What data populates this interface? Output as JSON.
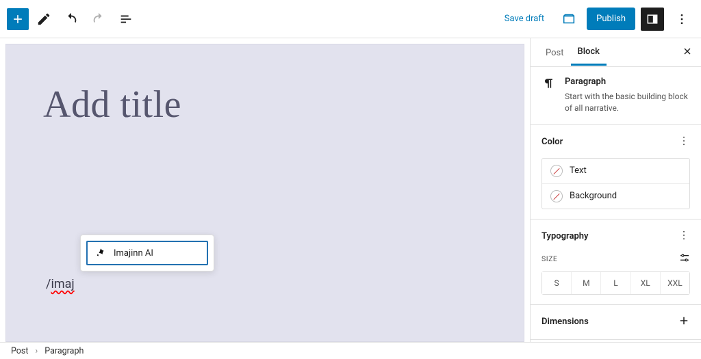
{
  "topbar": {
    "save_draft": "Save draft",
    "publish": "Publish"
  },
  "canvas": {
    "title_placeholder": "Add title",
    "slash_suggestion": "Imajinn AI",
    "slash_text_prefix": "/",
    "slash_text_typed": "imaj"
  },
  "sidebar": {
    "tabs": {
      "post": "Post",
      "block": "Block"
    },
    "block_info": {
      "name": "Paragraph",
      "desc": "Start with the basic building block of all narrative."
    },
    "sections": {
      "color": {
        "title": "Color",
        "options": {
          "text": "Text",
          "background": "Background"
        }
      },
      "typography": {
        "title": "Typography",
        "size_label": "SIZE",
        "sizes": [
          "S",
          "M",
          "L",
          "XL",
          "XXL"
        ]
      },
      "dimensions": {
        "title": "Dimensions"
      }
    }
  },
  "breadcrumb": {
    "root": "Post",
    "current": "Paragraph"
  }
}
